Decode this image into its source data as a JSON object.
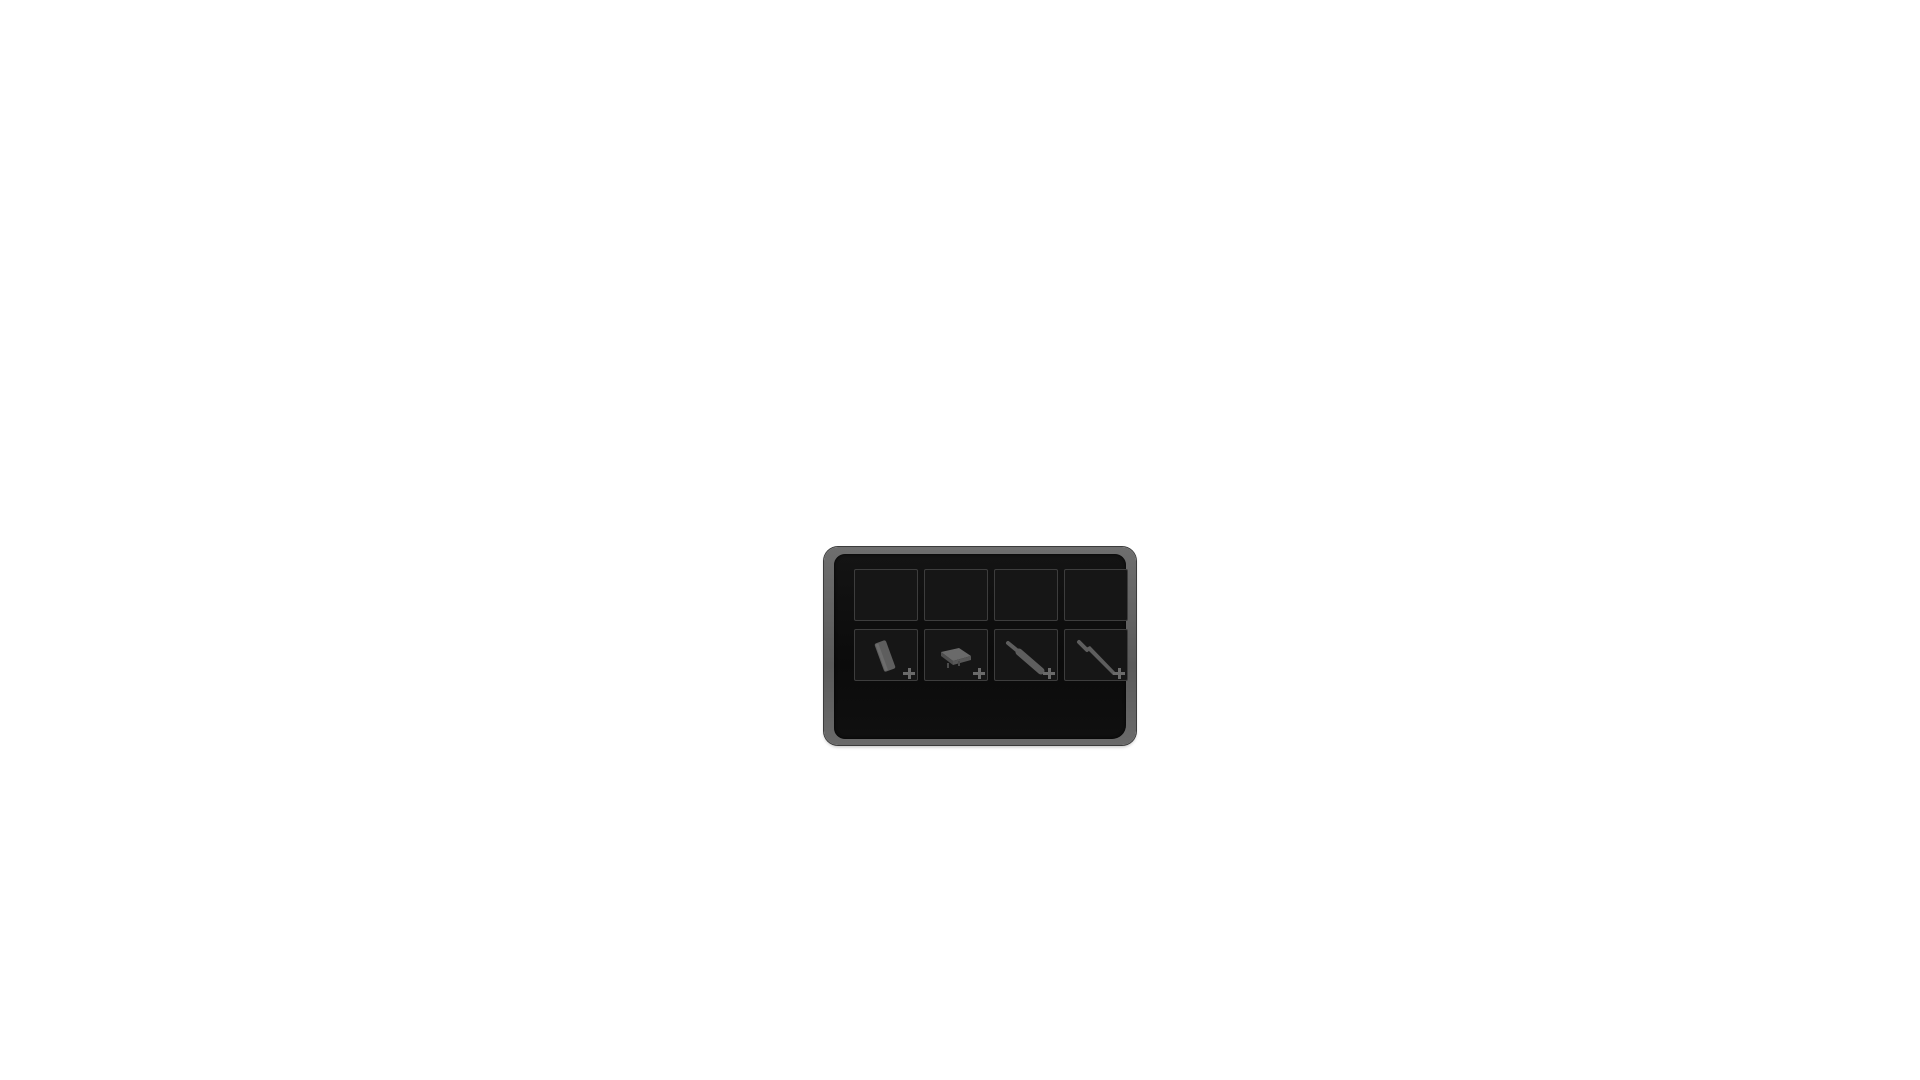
{
  "inventory": {
    "rows": 2,
    "columns": 4,
    "slots": [
      {
        "item": null,
        "icon": "empty-slot"
      },
      {
        "item": null,
        "icon": "empty-slot"
      },
      {
        "item": null,
        "icon": "empty-slot"
      },
      {
        "item": null,
        "icon": "empty-slot"
      },
      {
        "item": "bar",
        "icon": "bar-icon",
        "addable": true
      },
      {
        "item": "pack",
        "icon": "pack-icon",
        "addable": true
      },
      {
        "item": "bat",
        "icon": "bat-icon",
        "addable": true
      },
      {
        "item": "knife",
        "icon": "knife-icon",
        "addable": true
      }
    ]
  },
  "colors": {
    "frame": "#5f5f5f",
    "panel": "#0e0e0e",
    "slot_border": "#3d3d3d",
    "icon": "#5e5e5e"
  }
}
